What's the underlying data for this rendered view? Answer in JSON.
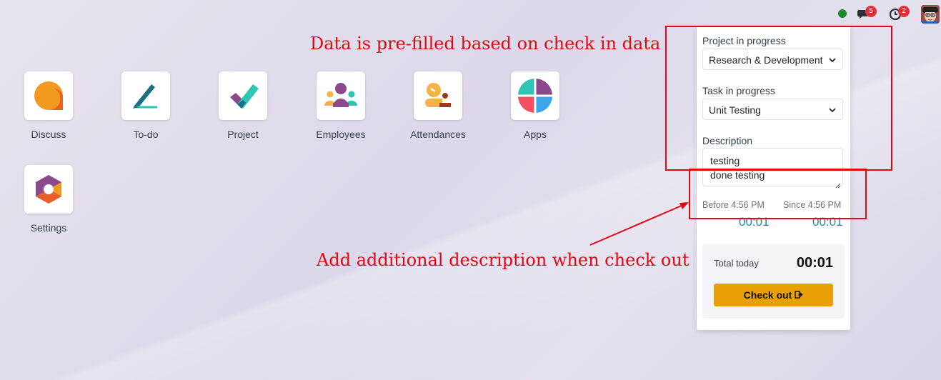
{
  "topbar": {
    "chat_badge": "5",
    "activity_badge": "2",
    "status_color": "#1a8a2f",
    "icons": [
      "status-dot",
      "chat-icon",
      "clock-icon",
      "avatar"
    ]
  },
  "apps": [
    {
      "label": "Discuss",
      "icon": "discuss-icon"
    },
    {
      "label": "To-do",
      "icon": "todo-icon"
    },
    {
      "label": "Project",
      "icon": "project-icon"
    },
    {
      "label": "Employees",
      "icon": "employees-icon"
    },
    {
      "label": "Attendances",
      "icon": "attendances-icon"
    },
    {
      "label": "Apps",
      "icon": "apps-icon"
    },
    {
      "label": "Settings",
      "icon": "settings-icon"
    }
  ],
  "panel": {
    "project_label": "Project in progress",
    "project_value": "Research & Development",
    "task_label": "Task in progress",
    "task_value": "Unit Testing",
    "description_label": "Description",
    "description_lines": [
      "testing",
      "done testing"
    ],
    "before_label": "Before 4:56 PM",
    "before_value": "00:01",
    "since_label": "Since 4:56 PM",
    "since_value": "00:01",
    "total_label": "Total today",
    "total_value": "00:01",
    "checkout_label": "Check out"
  },
  "annotations": {
    "top_text": "Data is pre-filled based on check in data",
    "bottom_text": "Add additional description when check out",
    "color": "#e30613"
  }
}
